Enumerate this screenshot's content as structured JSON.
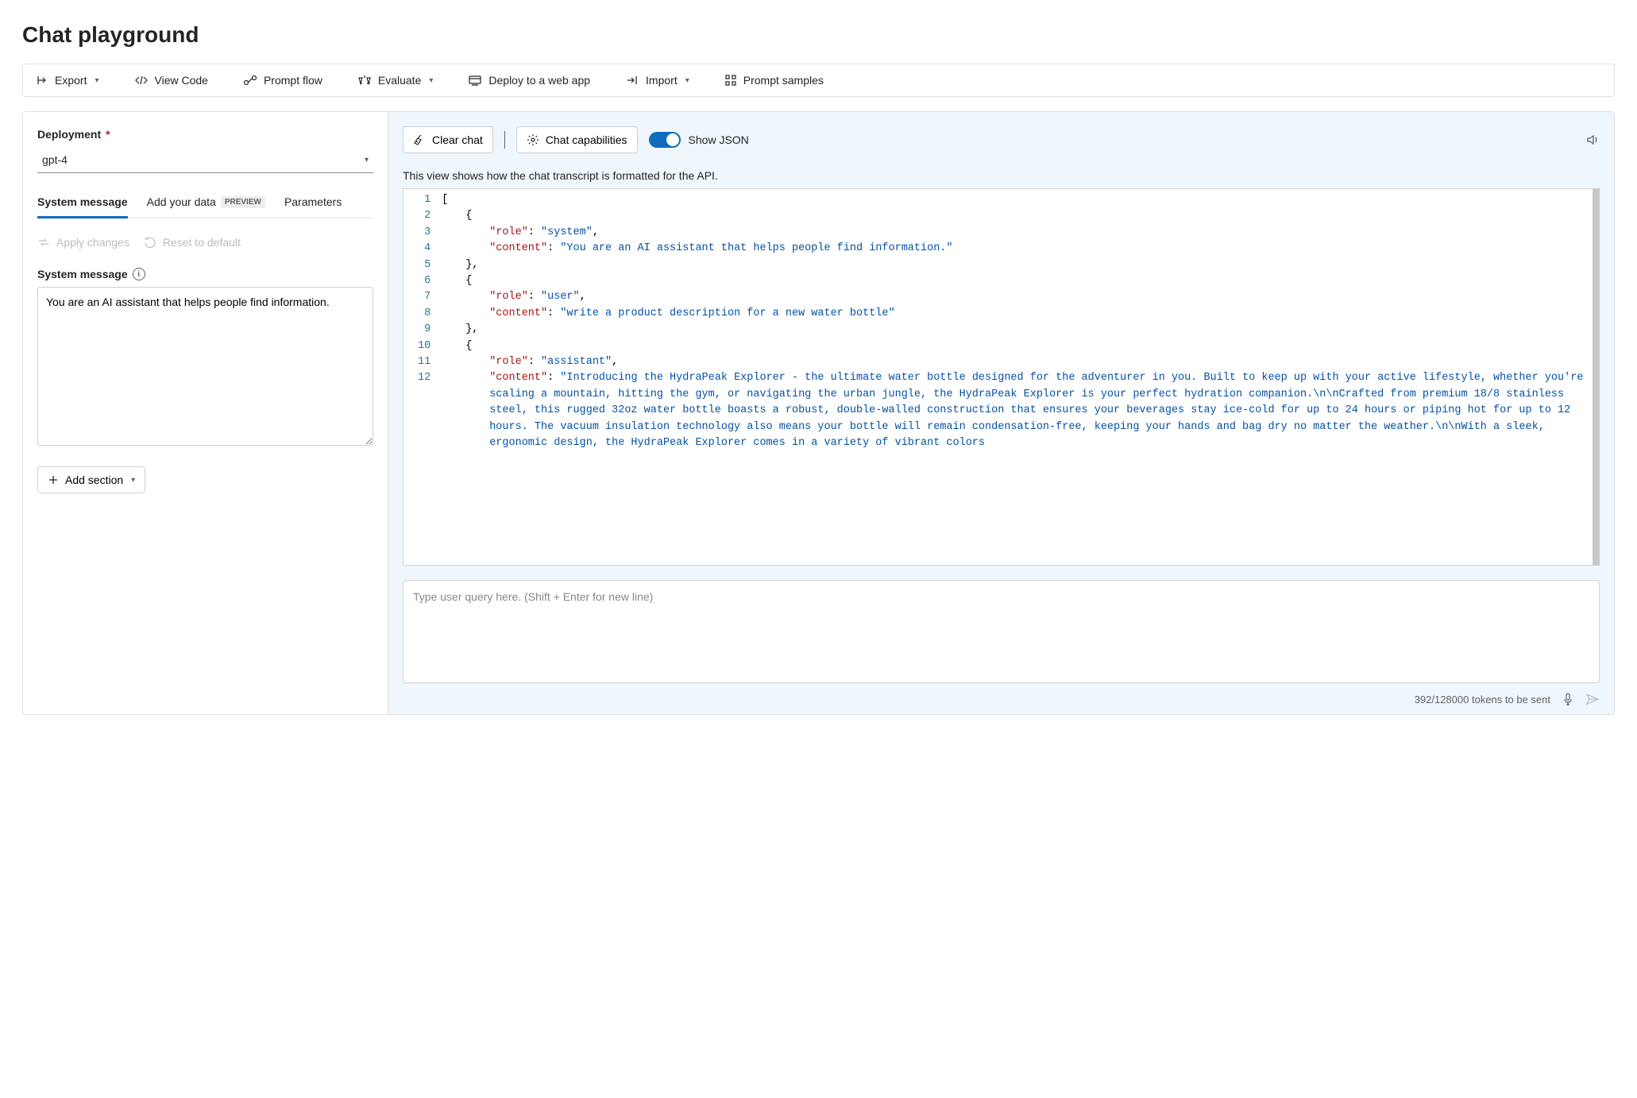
{
  "page_title": "Chat playground",
  "toolbar": {
    "export": "Export",
    "view_code": "View Code",
    "prompt_flow": "Prompt flow",
    "evaluate": "Evaluate",
    "deploy": "Deploy to a web app",
    "import": "Import",
    "prompt_samples": "Prompt samples"
  },
  "left": {
    "deployment_label": "Deployment",
    "deployment_value": "gpt-4",
    "tabs": {
      "system_message": "System message",
      "add_your_data": "Add your data",
      "add_your_data_badge": "PREVIEW",
      "parameters": "Parameters"
    },
    "apply_changes": "Apply changes",
    "reset_default": "Reset to default",
    "system_message_label": "System message",
    "system_message_value": "You are an AI assistant that helps people find information.",
    "add_section": "Add section"
  },
  "right": {
    "clear_chat": "Clear chat",
    "chat_capabilities": "Chat capabilities",
    "show_json": "Show JSON",
    "show_json_on": true,
    "transcript_desc": "This view shows how the chat transcript is formatted for the API.",
    "input_placeholder": "Type user query here. (Shift + Enter for new line)",
    "tokens_text": "392/128000 tokens to be sent"
  },
  "transcript": [
    {
      "role": "system",
      "content": "You are an AI assistant that helps people find information."
    },
    {
      "role": "user",
      "content": "write a product description for a new water bottle"
    },
    {
      "role": "assistant",
      "content": "Introducing the HydraPeak Explorer - the ultimate water bottle designed for the adventurer in you. Built to keep up with your active lifestyle, whether you're scaling a mountain, hitting the gym, or navigating the urban jungle, the HydraPeak Explorer is your perfect hydration companion.\\n\\nCrafted from premium 18/8 stainless steel, this rugged 32oz water bottle boasts a robust, double-walled construction that ensures your beverages stay ice-cold for up to 24 hours or piping hot for up to 12 hours. The vacuum insulation technology also means your bottle will remain condensation-free, keeping your hands and bag dry no matter the weather.\\n\\nWith a sleek, ergonomic design, the HydraPeak Explorer comes in a variety of vibrant colors"
    }
  ],
  "code_lines": 12
}
